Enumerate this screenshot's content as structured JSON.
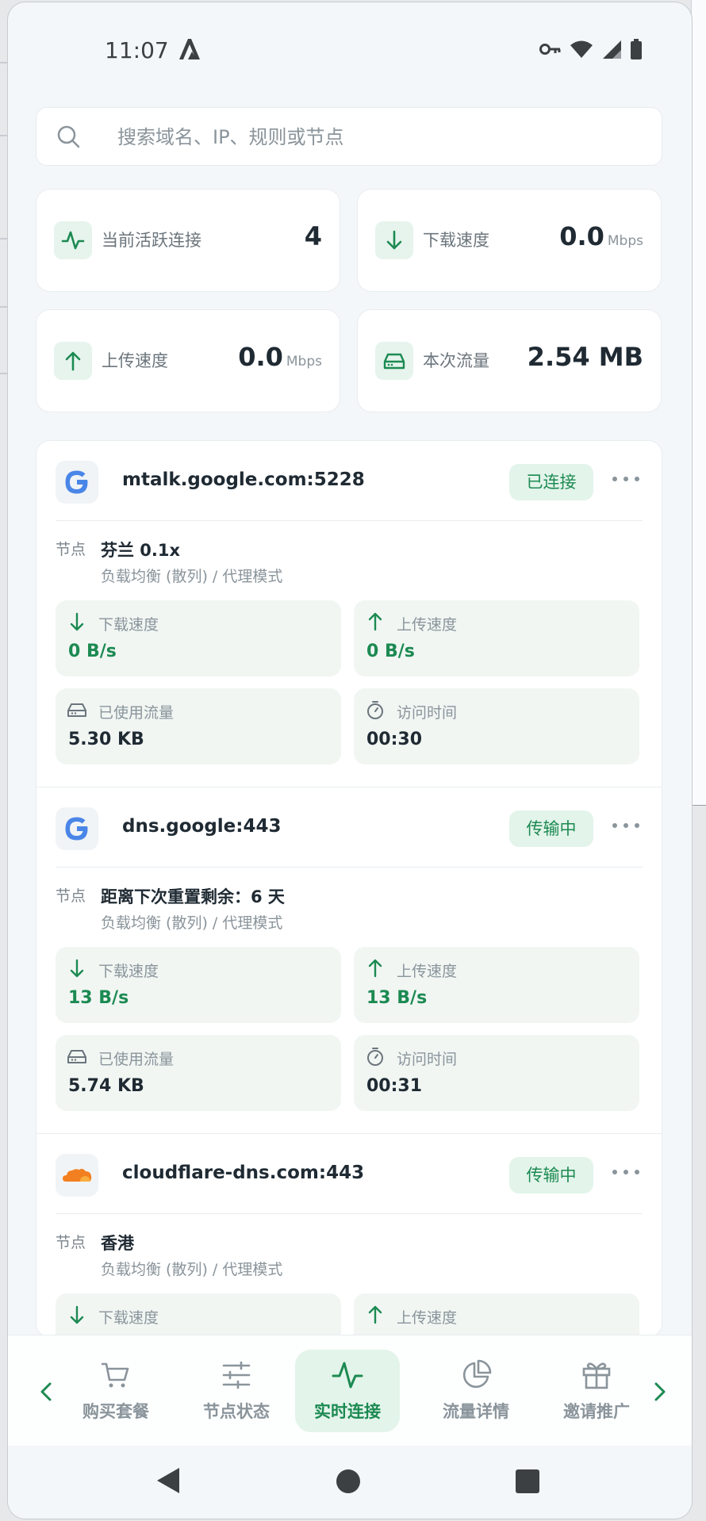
{
  "status_bar": {
    "time": "11:07",
    "icons": [
      "a-logo-icon",
      "key-icon",
      "wifi-icon",
      "signal-icon",
      "battery-icon"
    ]
  },
  "search": {
    "placeholder": "搜索域名、IP、规则或节点",
    "value": ""
  },
  "stats": {
    "active_connections": {
      "label": "当前活跃连接",
      "value": "4",
      "icon": "activity-icon"
    },
    "download_speed": {
      "label": "下载速度",
      "value": "0.0",
      "unit": "Mbps",
      "icon": "arrow-down-icon"
    },
    "upload_speed": {
      "label": "上传速度",
      "value": "0.0",
      "unit": "Mbps",
      "icon": "arrow-up-icon"
    },
    "session_traffic": {
      "label": "本次流量",
      "value": "2.54 MB",
      "icon": "hard-drive-icon"
    }
  },
  "connections": [
    {
      "host": "mtalk.google.com:5228",
      "favicon": "google-icon",
      "status": "已连接",
      "node_label": "节点",
      "node_name": "芬兰 0.1x",
      "node_mode": "负载均衡 (散列) / 代理模式",
      "download_label": "下载速度",
      "download": "0 B/s",
      "upload_label": "上传速度",
      "upload": "0 B/s",
      "used_label": "已使用流量",
      "used": "5.30 KB",
      "time_label": "访问时间",
      "time": "00:30"
    },
    {
      "host": "dns.google:443",
      "favicon": "google-icon",
      "status": "传输中",
      "node_label": "节点",
      "node_name": "距离下次重置剩余：6 天",
      "node_mode": "负载均衡 (散列) / 代理模式",
      "download_label": "下载速度",
      "download": "13 B/s",
      "upload_label": "上传速度",
      "upload": "13 B/s",
      "used_label": "已使用流量",
      "used": "5.74 KB",
      "time_label": "访问时间",
      "time": "00:31"
    },
    {
      "host": "cloudflare-dns.com:443",
      "favicon": "cloudflare-icon",
      "status": "传输中",
      "node_label": "节点",
      "node_name": "香港",
      "node_mode": "负载均衡 (散列) / 代理模式",
      "download_label": "下载速度",
      "upload_label": "上传速度"
    }
  ],
  "bottom_nav": {
    "items": [
      {
        "label": "购买套餐",
        "icon": "cart-icon",
        "active": false
      },
      {
        "label": "节点状态",
        "icon": "sliders-icon",
        "active": false
      },
      {
        "label": "实时连接",
        "icon": "activity-icon",
        "active": true
      },
      {
        "label": "流量详情",
        "icon": "pie-chart-icon",
        "active": false
      },
      {
        "label": "邀请推广",
        "icon": "gift-icon",
        "active": false
      }
    ]
  },
  "colors": {
    "accent": "#1c8a52",
    "accent_bg": "#e3f4ea",
    "tile_bg": "#f1f6f3",
    "page_bg": "#f4f7f9"
  }
}
